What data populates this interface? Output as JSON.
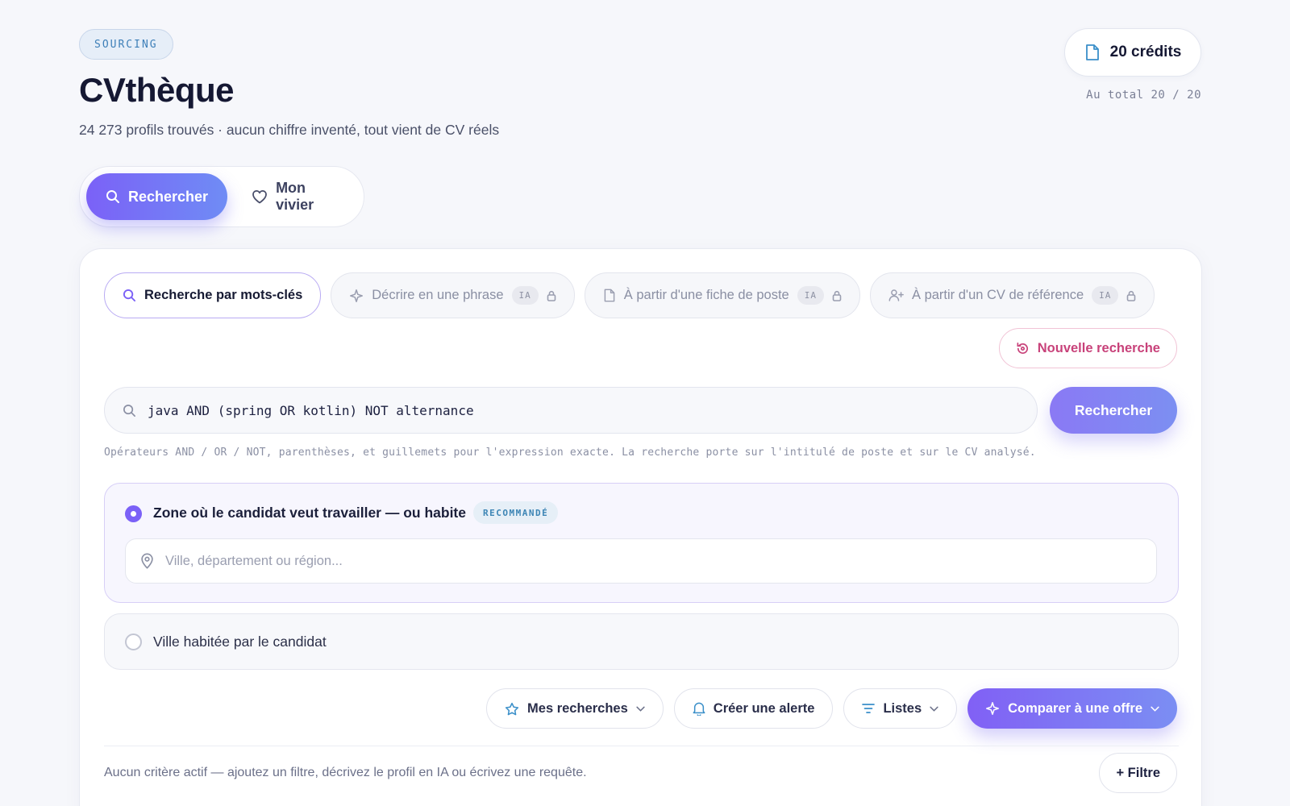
{
  "header": {
    "section_badge": "SOURCING",
    "title": "CVthèque",
    "subtitle": "24 273 profils trouvés · aucun chiffre inventé, tout vient de CV réels",
    "credits_label": "20 crédits",
    "credits_total": "Au total 20 / 20"
  },
  "mode_toggle": {
    "search_label": "Rechercher",
    "pool_label": "Mon vivier",
    "active": "search"
  },
  "search_tabs": [
    {
      "label": "Recherche par mots-clés",
      "icon": "search-icon",
      "active": true
    },
    {
      "label": "Décrire en une phrase",
      "icon": "sparkle-icon",
      "chip": "IA",
      "locked": true
    },
    {
      "label": "À partir d'une fiche de poste",
      "icon": "document-icon",
      "chip": "IA",
      "locked": true
    },
    {
      "label": "À partir d'un CV de référence",
      "icon": "user-plus-icon",
      "chip": "IA",
      "locked": true
    }
  ],
  "new_search_label": "Nouvelle recherche",
  "query": {
    "value": "java AND (spring OR kotlin) NOT alternance",
    "submit_label": "Rechercher",
    "help": "Opérateurs AND / OR / NOT, parenthèses, et guillemets pour l'expression exacte. La recherche porte sur l'intitulé de poste et sur le CV analysé."
  },
  "location": {
    "option_zone_label": "Zone où le candidat veut travailler — ou habite",
    "recommended_chip": "RECOMMANDÉ",
    "placeholder": "Ville, département ou région...",
    "option_city_label": "Ville habitée par le candidat",
    "selected": "zone"
  },
  "actions": {
    "saved_searches": "Mes recherches",
    "create_alert": "Créer une alerte",
    "lists": "Listes",
    "compare_offer": "Comparer à une offre"
  },
  "criteria": {
    "empty_text": "Aucun critère actif — ajoutez un filtre, décrivez le profil en IA ou écrivez une requête.",
    "add_filter": "+ Filtre"
  },
  "colors": {
    "accent": "#7b61f7",
    "accent_end": "#6f8cf5",
    "danger": "#c8427a",
    "info": "#3d85b5"
  }
}
